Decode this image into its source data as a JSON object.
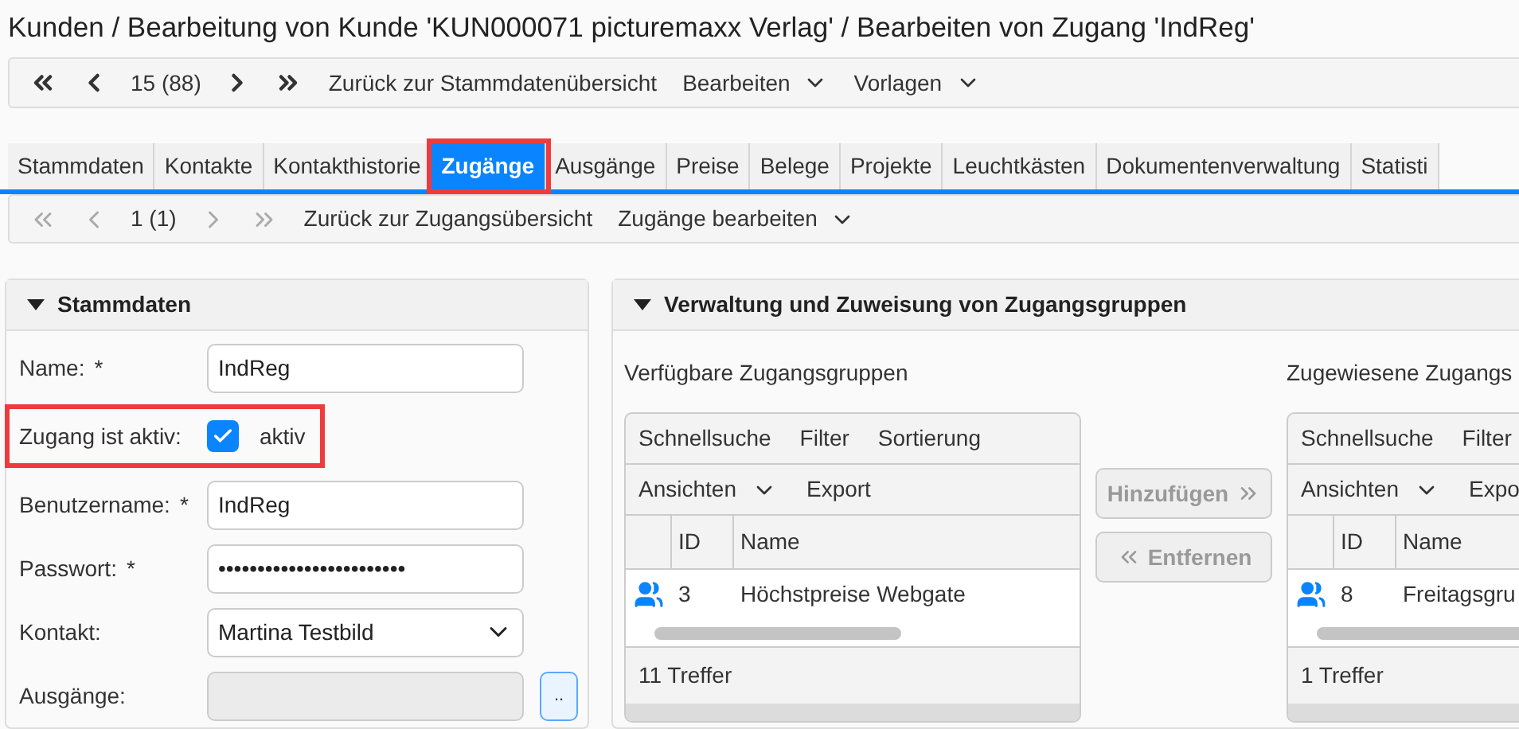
{
  "title": "Kunden / Bearbeitung von Kunde 'KUN000071 picturemaxx Verlag' / Bearbeiten von Zugang 'IndReg'",
  "record_nav": {
    "position": "15 (88)",
    "enabled": true,
    "items": [
      {
        "label": "Zurück zur Stammdatenübersicht",
        "dropdown": false
      },
      {
        "label": "Bearbeiten",
        "dropdown": true
      },
      {
        "label": "Vorlagen",
        "dropdown": true
      }
    ]
  },
  "tabs": [
    {
      "label": "Stammdaten",
      "selected": false,
      "highlighted": false
    },
    {
      "label": "Kontakte",
      "selected": false,
      "highlighted": false
    },
    {
      "label": "Kontakthistorie",
      "selected": false,
      "highlighted": false
    },
    {
      "label": "Zugänge",
      "selected": true,
      "highlighted": true
    },
    {
      "label": "Ausgänge",
      "selected": false,
      "highlighted": false
    },
    {
      "label": "Preise",
      "selected": false,
      "highlighted": false
    },
    {
      "label": "Belege",
      "selected": false,
      "highlighted": false
    },
    {
      "label": "Projekte",
      "selected": false,
      "highlighted": false
    },
    {
      "label": "Leuchtkästen",
      "selected": false,
      "highlighted": false
    },
    {
      "label": "Dokumentenverwaltung",
      "selected": false,
      "highlighted": false
    },
    {
      "label": "Statisti",
      "selected": false,
      "highlighted": false
    }
  ],
  "sub_nav": {
    "position": "1 (1)",
    "enabled": false,
    "items": [
      {
        "label": "Zurück zur Zugangsübersicht",
        "dropdown": false
      },
      {
        "label": "Zugänge bearbeiten",
        "dropdown": true
      }
    ]
  },
  "stammdaten": {
    "title": "Stammdaten",
    "expanded": true,
    "fields": [
      {
        "kind": "text",
        "label": "Name:",
        "marker": "*",
        "value": "IndReg",
        "highlighted": false
      },
      {
        "kind": "checkbox",
        "label": "Zugang ist aktiv:",
        "checked": true,
        "option": "aktiv",
        "highlighted": true
      },
      {
        "kind": "text",
        "label": "Benutzername:",
        "marker": "*",
        "value": "IndReg",
        "highlighted": false
      },
      {
        "kind": "text",
        "label": "Passwort:",
        "marker": "*",
        "value": "••••••••••••••••••••••••",
        "highlighted": false
      },
      {
        "kind": "select",
        "label": "Kontakt:",
        "value": "Martina Testbild",
        "highlighted": false
      },
      {
        "kind": "picker",
        "label": "Ausgänge:",
        "button": "..",
        "disabled": true,
        "highlighted": false
      }
    ]
  },
  "zugangsgruppen": {
    "title": "Verwaltung und Zuweisung von Zugangsgruppen",
    "expanded": true,
    "available": {
      "title": "Verfügbare Zugangsgruppen",
      "toolbar": [
        [
          {
            "label": "Schnellsuche",
            "dropdown": false
          },
          {
            "label": "Filter",
            "dropdown": false
          },
          {
            "label": "Sortierung",
            "dropdown": false
          }
        ],
        [
          {
            "label": "Ansichten",
            "dropdown": true
          },
          {
            "label": "Export",
            "dropdown": false
          }
        ]
      ],
      "columns": [
        "ID",
        "Name"
      ],
      "rows": [
        {
          "id": "3",
          "name": "Höchstpreise Webgate"
        }
      ],
      "footer": "11 Treffer"
    },
    "actions": [
      {
        "kind": "add",
        "label": "Hinzufügen",
        "disabled": true
      },
      {
        "kind": "remove",
        "label": "Entfernen",
        "disabled": true
      }
    ],
    "assigned": {
      "title": "Zugewiesene Zugangs",
      "toolbar": [
        [
          {
            "label": "Schnellsuche",
            "dropdown": false
          },
          {
            "label": "Filter",
            "dropdown": false
          }
        ],
        [
          {
            "label": "Ansichten",
            "dropdown": true
          },
          {
            "label": "Expo",
            "dropdown": false
          }
        ]
      ],
      "columns": [
        "ID",
        "Name"
      ],
      "rows": [
        {
          "id": "8",
          "name": "Freitagsgru"
        }
      ],
      "footer": "1 Treffer"
    }
  }
}
